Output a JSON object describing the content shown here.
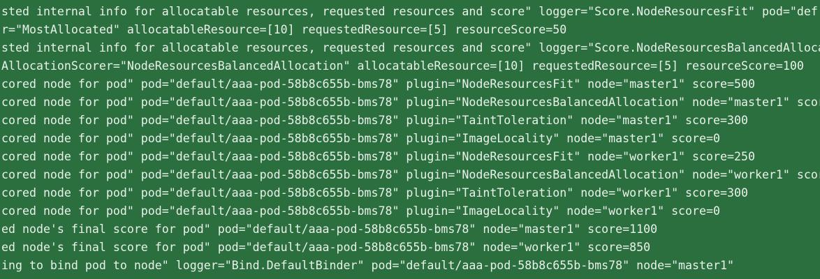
{
  "terminal": {
    "lines": [
      "sted internal info for allocatable resources, requested resources and score\" logger=\"Score.NodeResourcesFit\" pod=\"def",
      "r=\"MostAllocated\" allocatableResource=[10] requestedResource=[5] resourceScore=50",
      "sted internal info for allocatable resources, requested resources and score\" logger=\"Score.NodeResourcesBalancedAlloca",
      "AllocationScorer=\"NodeResourcesBalancedAllocation\" allocatableResource=[10] requestedResource=[5] resourceScore=100",
      "cored node for pod\" pod=\"default/aaa-pod-58b8c655b-bms78\" plugin=\"NodeResourcesFit\" node=\"master1\" score=500",
      "cored node for pod\" pod=\"default/aaa-pod-58b8c655b-bms78\" plugin=\"NodeResourcesBalancedAllocation\" node=\"master1\" scor",
      "cored node for pod\" pod=\"default/aaa-pod-58b8c655b-bms78\" plugin=\"TaintToleration\" node=\"master1\" score=300",
      "cored node for pod\" pod=\"default/aaa-pod-58b8c655b-bms78\" plugin=\"ImageLocality\" node=\"master1\" score=0",
      "cored node for pod\" pod=\"default/aaa-pod-58b8c655b-bms78\" plugin=\"NodeResourcesFit\" node=\"worker1\" score=250",
      "cored node for pod\" pod=\"default/aaa-pod-58b8c655b-bms78\" plugin=\"NodeResourcesBalancedAllocation\" node=\"worker1\" scor",
      "cored node for pod\" pod=\"default/aaa-pod-58b8c655b-bms78\" plugin=\"TaintToleration\" node=\"worker1\" score=300",
      "cored node for pod\" pod=\"default/aaa-pod-58b8c655b-bms78\" plugin=\"ImageLocality\" node=\"worker1\" score=0",
      "ed node's final score for pod\" pod=\"default/aaa-pod-58b8c655b-bms78\" node=\"master1\" score=1100",
      "ed node's final score for pod\" pod=\"default/aaa-pod-58b8c655b-bms78\" node=\"worker1\" score=850",
      "ing to bind pod to node\" logger=\"Bind.DefaultBinder\" pod=\"default/aaa-pod-58b8c655b-bms78\" node=\"master1\""
    ]
  },
  "colors": {
    "background": "#2b6f3f",
    "text": "#e9f2ea"
  }
}
